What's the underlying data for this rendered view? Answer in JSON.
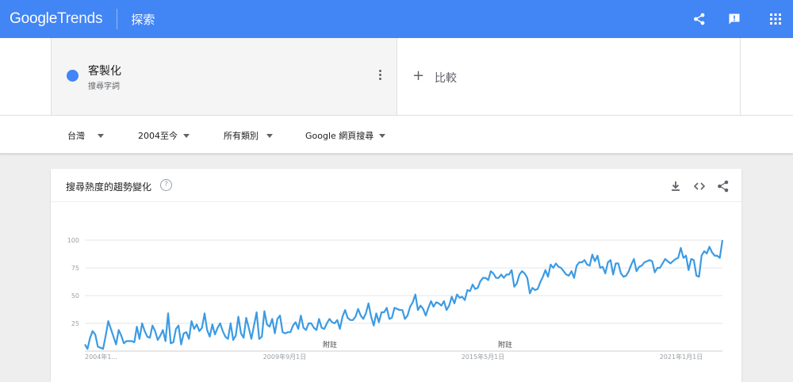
{
  "appbar": {
    "logo_google": "Google",
    "logo_trends": "Trends",
    "title": "探索",
    "icons": [
      "share-icon",
      "feedback-icon",
      "apps-grid-icon"
    ]
  },
  "compare": {
    "term": "客製化",
    "term_type": "搜尋字詞",
    "term_color": "#4285f4",
    "add_label": "比較"
  },
  "filters": {
    "region": "台灣",
    "period": "2004至今",
    "category": "所有類別",
    "property": "Google 網頁搜尋"
  },
  "card": {
    "title": "搜尋熱度的趨勢變化",
    "help": "?",
    "icons": [
      "download-icon",
      "embed-icon",
      "share-icon"
    ]
  },
  "chart_data": {
    "type": "line",
    "title": "",
    "xlabel": "",
    "ylabel": "",
    "ylim": [
      0,
      100
    ],
    "yticks": [
      25,
      50,
      75,
      100
    ],
    "x_tick_labels": [
      "2004年1...",
      "2009年9月1日",
      "2015年5月1日",
      "2021年1月1日"
    ],
    "annotations": [
      "附註",
      "附註"
    ],
    "line_color": "#3b9be3",
    "grid": true,
    "legend": "none",
    "series": [
      {
        "values": [
          6,
          2,
          12,
          18,
          15,
          4,
          3,
          2,
          14,
          27,
          20,
          13,
          6,
          19,
          14,
          7,
          9,
          9,
          9,
          8,
          22,
          11,
          25,
          18,
          13,
          12,
          23,
          18,
          10,
          14,
          19,
          9,
          34,
          7,
          8,
          20,
          23,
          6,
          16,
          17,
          11,
          27,
          20,
          24,
          18,
          21,
          34,
          19,
          13,
          24,
          15,
          21,
          25,
          18,
          13,
          11,
          25,
          10,
          14,
          31,
          16,
          12,
          30,
          21,
          11,
          23,
          35,
          11,
          13,
          36,
          24,
          22,
          29,
          16,
          29,
          32,
          17,
          16,
          17,
          17,
          23,
          26,
          20,
          32,
          21,
          19,
          25,
          25,
          21,
          19,
          29,
          21,
          20,
          25,
          29,
          26,
          25,
          28,
          20,
          31,
          37,
          30,
          28,
          28,
          31,
          38,
          32,
          29,
          34,
          43,
          31,
          23,
          34,
          26,
          35,
          35,
          39,
          29,
          30,
          39,
          38,
          37,
          37,
          29,
          32,
          40,
          44,
          51,
          37,
          41,
          38,
          32,
          39,
          45,
          40,
          44,
          43,
          41,
          45,
          37,
          41,
          49,
          43,
          51,
          48,
          49,
          46,
          55,
          54,
          60,
          56,
          57,
          63,
          66,
          66,
          64,
          72,
          70,
          66,
          66,
          69,
          66,
          69,
          69,
          73,
          58,
          61,
          69,
          72,
          70,
          66,
          52,
          57,
          55,
          56,
          62,
          67,
          73,
          67,
          78,
          75,
          79,
          76,
          75,
          72,
          69,
          68,
          72,
          66,
          77,
          80,
          80,
          82,
          78,
          77,
          87,
          81,
          86,
          75,
          76,
          70,
          80,
          82,
          69,
          79,
          79,
          70,
          67,
          68,
          72,
          78,
          83,
          72,
          76,
          77,
          80,
          81,
          82,
          81,
          71,
          75,
          75,
          79,
          83,
          81,
          79,
          81,
          83,
          84,
          93,
          84,
          86,
          73,
          83,
          82,
          68,
          67,
          86,
          90,
          88,
          94,
          89,
          86,
          86,
          84,
          100
        ]
      }
    ]
  }
}
